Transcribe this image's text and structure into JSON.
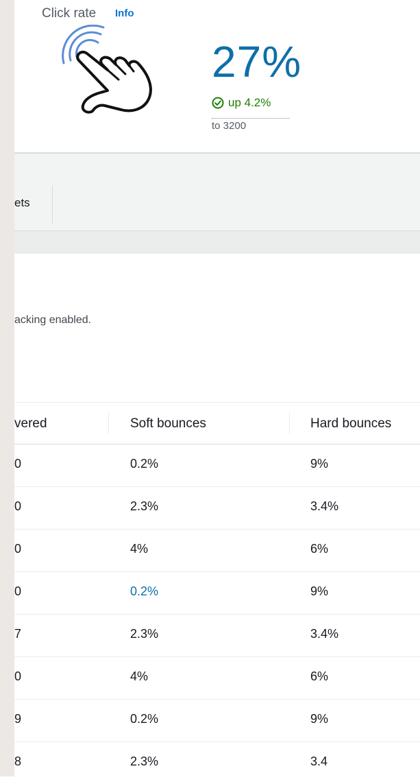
{
  "metric": {
    "title": "Click rate",
    "info_label": "Info",
    "icon": "tap-hand-icon",
    "value": "27%",
    "trend_text": "up 4.2%",
    "trend_icon": "check-circle-icon",
    "baseline": "to 3200",
    "value_color": "#0f6ea8",
    "trend_color": "#1d8102"
  },
  "tabs": {
    "partial_label": "ets"
  },
  "note": {
    "text": "acking enabled."
  },
  "table": {
    "columns": [
      "vered",
      "Soft bounces",
      "Hard bounces"
    ],
    "rows": [
      {
        "delivered": "0",
        "soft": "0.2%",
        "hard": "9%"
      },
      {
        "delivered": "0",
        "soft": "2.3%",
        "hard": "3.4%"
      },
      {
        "delivered": "0",
        "soft": "4%",
        "hard": "6%"
      },
      {
        "delivered": "0",
        "soft": "0.2%",
        "hard": "9%"
      },
      {
        "delivered": "7",
        "soft": "2.3%",
        "hard": "3.4%"
      },
      {
        "delivered": "0",
        "soft": "4%",
        "hard": "6%"
      },
      {
        "delivered": "9",
        "soft": "0.2%",
        "hard": "9%"
      },
      {
        "delivered": "8",
        "soft": "2.3%",
        "hard": "3.4"
      }
    ]
  }
}
